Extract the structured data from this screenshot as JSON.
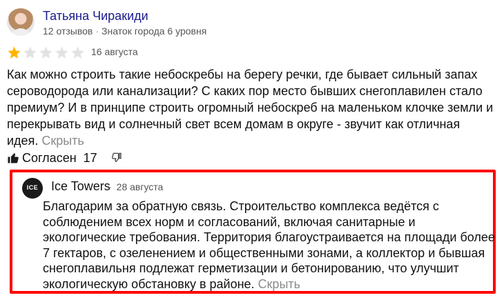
{
  "review": {
    "author_name": "Татьяна Чиракиди",
    "reviews_count": "12 отзывов",
    "level": "Знаток города 6 уровня",
    "rating": 1,
    "rating_max": 5,
    "date": "16 августа",
    "text": "Как можно строить такие небоскребы на берегу речки, где бывает сильный запах сероводорода или канализации? С каких пор место бывших снегоплавилен стало премиум? И в принципе строить огромный небоскреб на маленьком клочке земли и перекрывать вид и солнечный свет всем домам в округе - звучит как отличная идея.",
    "hide_label": "Скрыть",
    "like_label": "Согласен",
    "like_count": "17"
  },
  "reply": {
    "business_name": "Ice Towers",
    "logo_text": "ICE",
    "date": "28 августа",
    "text": "Благодарим за обратную связь. Строительство комплекса ведётся с соблюдением всех норм и согласований, включая санитарные и экологические требования. Территория благоустраивается на площади более 7 гектаров, с озеленением и общественными зонами, а коллектор и бывшая снегоплавильня подлежат герметизации и бетонированию, что улучшит экологическую обстановку в районе.",
    "hide_label": "Скрыть"
  },
  "colors": {
    "star_filled": "#ffb400",
    "star_empty": "#e2e2e2",
    "author_name": "#1a1a8c",
    "highlight_border": "#ff0000",
    "muted_text": "#8a8a8a"
  }
}
